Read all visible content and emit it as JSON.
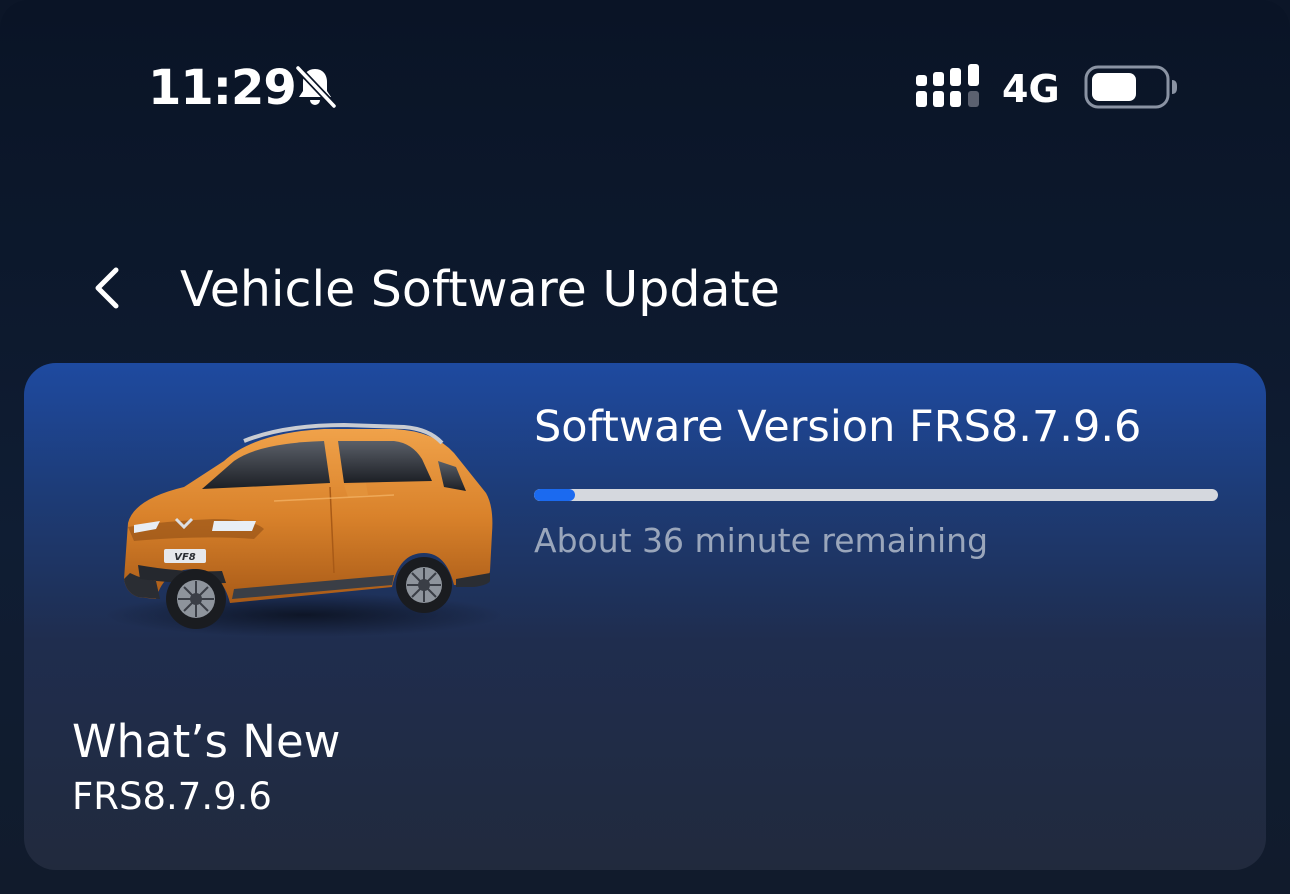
{
  "status_bar": {
    "time": "11:29",
    "network": "4G",
    "icons": [
      "bell-slash-icon",
      "signal-icon",
      "battery-icon"
    ]
  },
  "header": {
    "title": "Vehicle Software Update",
    "back_icon": "chevron-left-icon"
  },
  "update_card": {
    "version_title": "Software Version FRS8.7.9.6",
    "progress_fraction": 0.06,
    "remaining_text": "About 36 minute remaining",
    "car_image": "vinfast-vf8-orange",
    "car_badge": "VF8",
    "colors": {
      "progress_fill": "#1b6af0",
      "progress_track": "#d5d8de",
      "car_body": "#d9822b"
    }
  },
  "whats_new": {
    "title": "What’s New",
    "version": "FRS8.7.9.6"
  }
}
